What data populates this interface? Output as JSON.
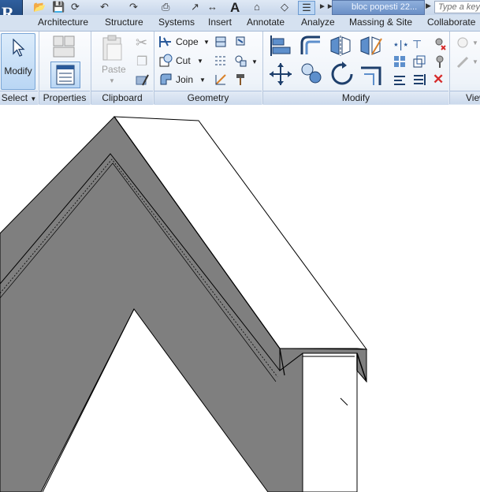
{
  "quick_access": {
    "text_tool_glyph": "A",
    "document_title": "bloc popesti 22...",
    "search_placeholder": "Type a keyword"
  },
  "tabs": [
    {
      "label": "Architecture"
    },
    {
      "label": "Structure"
    },
    {
      "label": "Systems"
    },
    {
      "label": "Insert"
    },
    {
      "label": "Annotate"
    },
    {
      "label": "Analyze"
    },
    {
      "label": "Massing & Site"
    },
    {
      "label": "Collaborate"
    }
  ],
  "ribbon": {
    "select": {
      "button_label": "Modify",
      "panel_title": "Select",
      "dropdown_icon": "chevron-down-icon"
    },
    "properties": {
      "panel_title": "Properties"
    },
    "clipboard": {
      "paste_label": "Paste",
      "panel_title": "Clipboard"
    },
    "geometry": {
      "cope_label": "Cope",
      "cut_label": "Cut",
      "join_label": "Join",
      "panel_title": "Geometry"
    },
    "modify": {
      "panel_title": "Modify"
    },
    "view": {
      "panel_title": "View"
    }
  },
  "colors": {
    "ribbon_bg": "#eef3f9",
    "tab_bar_bg": "#d5e1f0",
    "selected_button": "#b9d6f4",
    "roof_section_fill": "#7f7f7f",
    "model_edge": "#000000"
  }
}
